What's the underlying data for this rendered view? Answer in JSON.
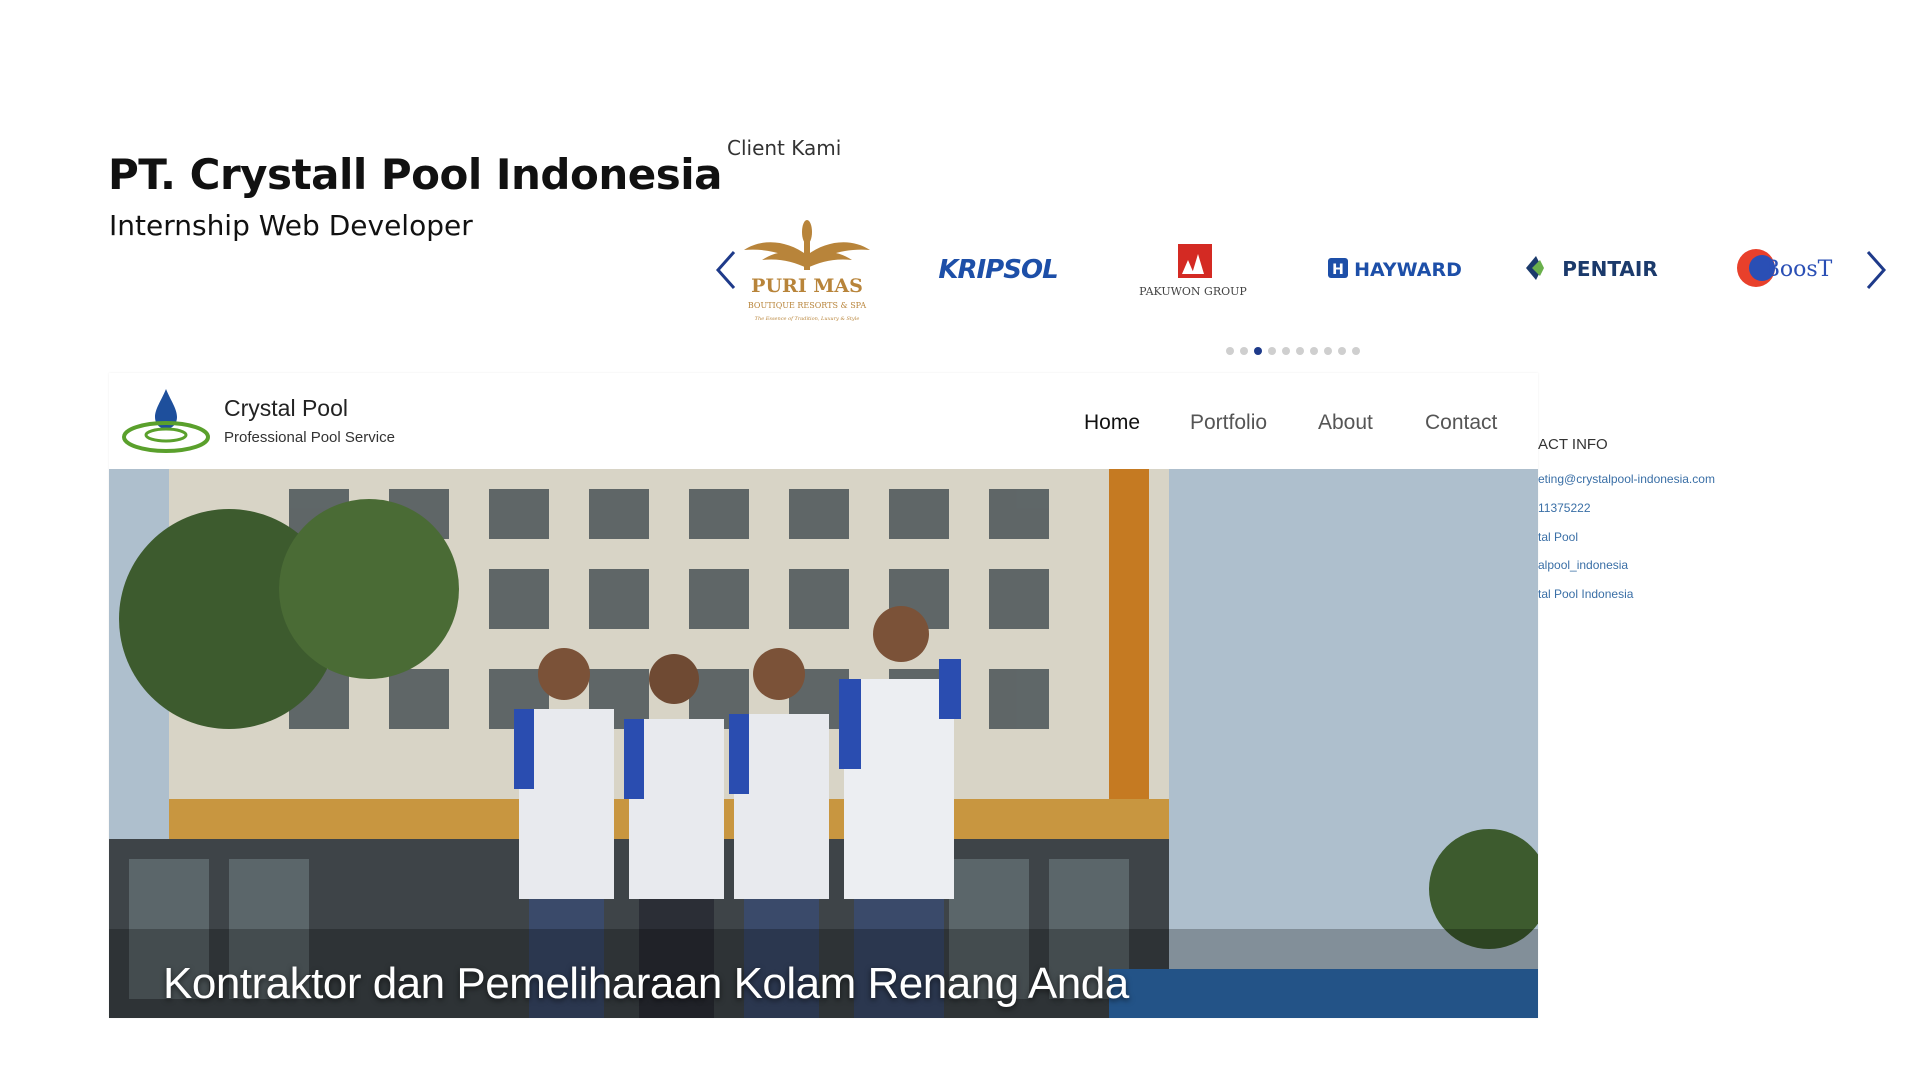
{
  "header": {
    "title": "PT. Crystall Pool Indonesia",
    "subtitle": "Internship Web Developer"
  },
  "clients": {
    "label": "Client Kami",
    "logos": [
      {
        "icon": "puri-mas-logo",
        "name": "PURI MAS",
        "tagline": "BOUTIQUE RESORTS & SPA",
        "motto": "The Essence of Tradition, Luxury & Style"
      },
      {
        "icon": "kripsol-logo",
        "name": "KRIPSOL"
      },
      {
        "icon": "pakuwon-logo",
        "name": "PAKUWON GROUP"
      },
      {
        "icon": "hayward-logo",
        "name": "HAYWARD"
      },
      {
        "icon": "pentair-logo",
        "name": "PENTAIR"
      },
      {
        "icon": "boost-logo",
        "name": "BoosT"
      }
    ],
    "active_dot": 2,
    "dot_count": 10,
    "accent_color": "#1e3a8a"
  },
  "site": {
    "brand_name": "Crystal Pool",
    "brand_tagline": "Professional Pool Service",
    "nav": [
      "Home",
      "Portfolio",
      "About",
      "Contact"
    ],
    "active_nav": "Home",
    "hero_caption": "Kontraktor dan Pemeliharaan Kolam Renang Anda"
  },
  "contact": {
    "title": "ACT INFO",
    "items": [
      "eting@crystalpool-indonesia.com",
      "11375222",
      "tal Pool",
      "alpool_indonesia",
      "tal Pool Indonesia"
    ],
    "link_color": "#3a6fa6"
  }
}
